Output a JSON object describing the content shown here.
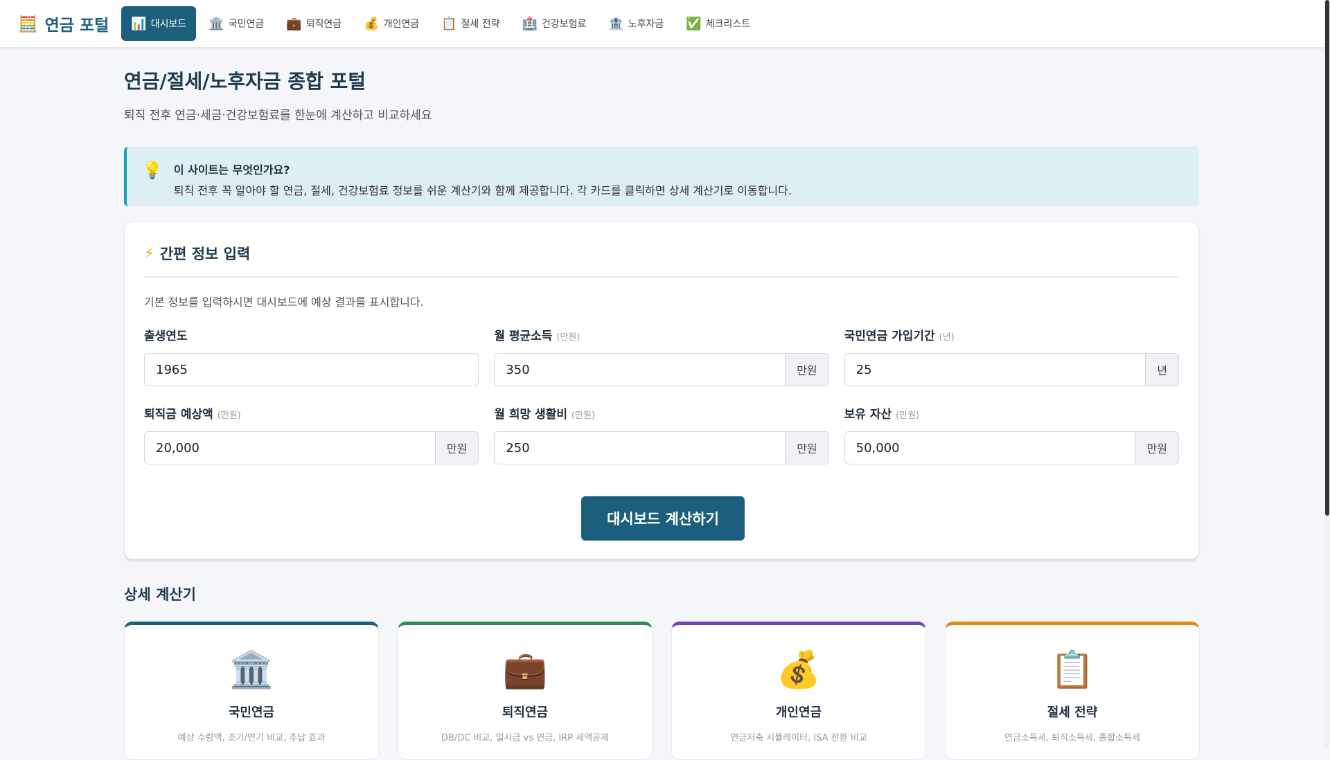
{
  "nav": {
    "logo_icon": "abacus-icon",
    "logo": "연금 포털",
    "items": [
      {
        "icon": "📊",
        "label": "대시보드",
        "active": true
      },
      {
        "icon": "🏛️",
        "label": "국민연금"
      },
      {
        "icon": "💼",
        "label": "퇴직연금"
      },
      {
        "icon": "💰",
        "label": "개인연금"
      },
      {
        "icon": "📋",
        "label": "절세 전략"
      },
      {
        "icon": "🏥",
        "label": "건강보험료"
      },
      {
        "icon": "🏦",
        "label": "노후자금"
      },
      {
        "icon": "✅",
        "label": "체크리스트"
      }
    ]
  },
  "page": {
    "title": "연금/절세/노후자금 종합 포털",
    "subtitle": "퇴직 전후 연금·세금·건강보험료를 한눈에 계산하고 비교하세요"
  },
  "info": {
    "title": "이 사이트는 무엇인가요?",
    "text": "퇴직 전후 꼭 알아야 할 연금, 절세, 건강보험료 정보를 쉬운 계산기와 함께 제공합니다. 각 카드를 클릭하면 상세 계산기로 이동합니다."
  },
  "form": {
    "title": "간편 정보 입력",
    "desc": "기본 정보를 입력하시면 대시보드에 예상 결과를 표시합니다.",
    "fields": [
      {
        "label": "출생연도",
        "hint": "",
        "value": "1965",
        "unit": ""
      },
      {
        "label": "월 평균소득",
        "hint": "(만원)",
        "value": "350",
        "unit": "만원"
      },
      {
        "label": "국민연금 가입기간",
        "hint": "(년)",
        "value": "25",
        "unit": "년"
      },
      {
        "label": "퇴직금 예상액",
        "hint": "(만원)",
        "value": "20,000",
        "unit": "만원"
      },
      {
        "label": "월 희망 생활비",
        "hint": "(만원)",
        "value": "250",
        "unit": "만원"
      },
      {
        "label": "보유 자산",
        "hint": "(만원)",
        "value": "50,000",
        "unit": "만원"
      }
    ],
    "button": "대시보드 계산하기"
  },
  "section": {
    "title": "상세 계산기"
  },
  "cards": [
    {
      "icon": "🏛️",
      "title": "국민연금",
      "desc": "예상 수령액, 조기/연기 비교, 추납 효과",
      "color": "#1c5f7c"
    },
    {
      "icon": "💼",
      "title": "퇴직연금",
      "desc": "DB/DC 비교, 일시금 vs 연금, IRP 세액공제",
      "color": "#2e8b57"
    },
    {
      "icon": "💰",
      "title": "개인연금",
      "desc": "연금저축 시뮬레이터, ISA 전환 비교",
      "color": "#6f42c1"
    },
    {
      "icon": "📋",
      "title": "절세 전략",
      "desc": "연금소득세, 퇴직소득세, 종합소득세",
      "color": "#e8870e"
    }
  ]
}
